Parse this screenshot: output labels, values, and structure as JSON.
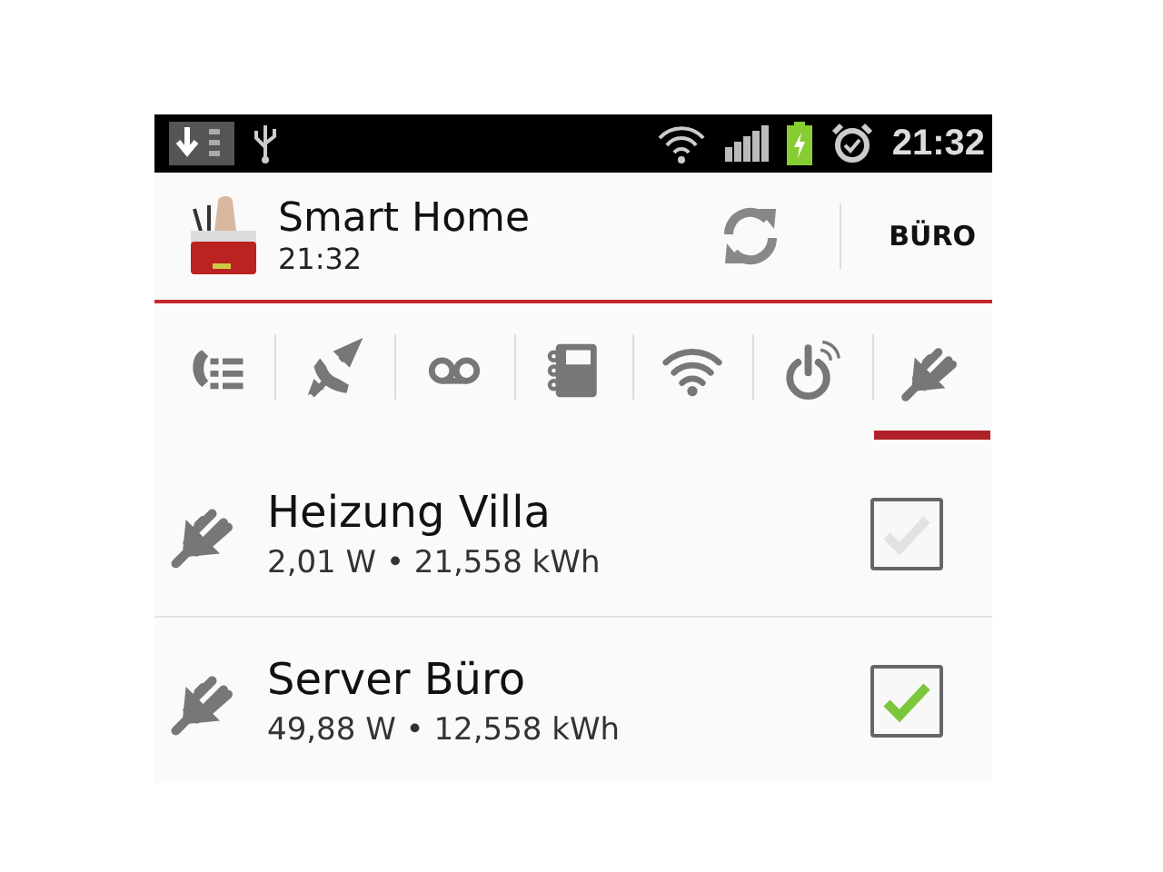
{
  "status_bar": {
    "time": "21:32"
  },
  "header": {
    "title": "Smart Home",
    "subtitle": "21:32",
    "profile": "BÜRO"
  },
  "tabs": [
    {
      "kind": "calls",
      "selected": false
    },
    {
      "kind": "callthrough",
      "selected": false
    },
    {
      "kind": "voicemail",
      "selected": false
    },
    {
      "kind": "phonebook",
      "selected": false
    },
    {
      "kind": "wifi",
      "selected": false
    },
    {
      "kind": "power",
      "selected": false
    },
    {
      "kind": "smarthome",
      "selected": true
    }
  ],
  "devices": [
    {
      "name": "Heizung Villa",
      "reading": "2,01 W • 21,558 kWh",
      "checked": false
    },
    {
      "name": "Server Büro",
      "reading": "49,88 W • 12,558 kWh",
      "checked": true
    }
  ]
}
